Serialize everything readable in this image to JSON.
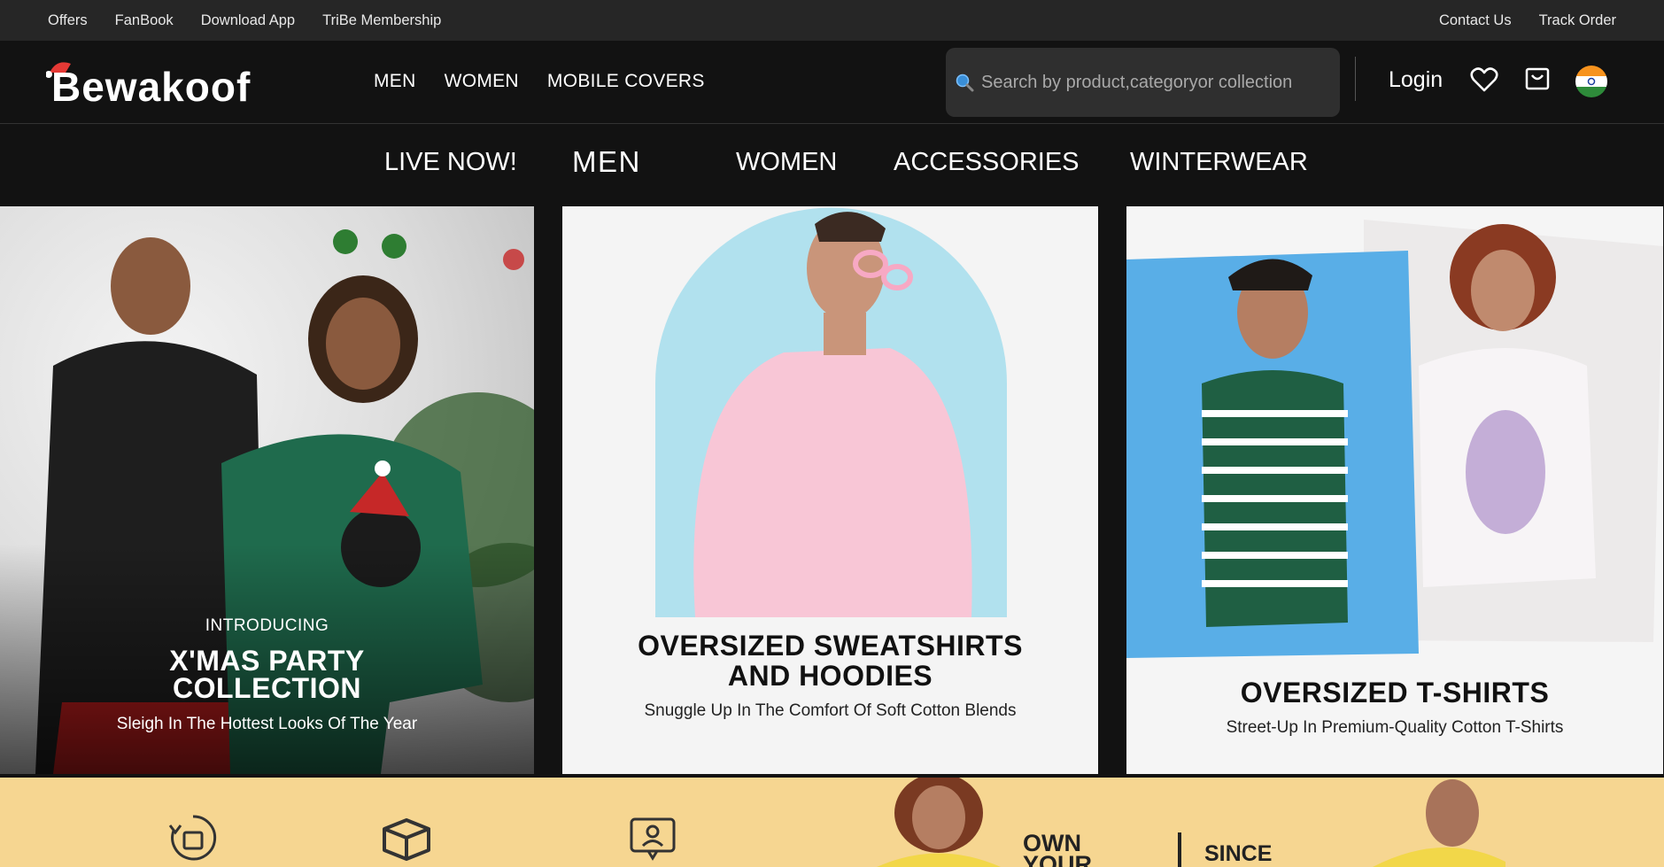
{
  "topbar": {
    "left_links": [
      "Offers",
      "FanBook",
      "Download App",
      "TriBe Membership"
    ],
    "right_links": [
      "Contact Us",
      "Track Order"
    ]
  },
  "header": {
    "logo_text": "Bewakoof",
    "nav": [
      "MEN",
      "WOMEN",
      "MOBILE COVERS"
    ],
    "search_placeholder": "Search by product,categoryor collection",
    "login_label": "Login"
  },
  "categories": [
    "LIVE NOW!",
    "MEN",
    "WOMEN",
    "ACCESSORIES",
    "WINTERWEAR"
  ],
  "banners": [
    {
      "intro": "INTRODUCING",
      "title_line1": "X'MAS PARTY",
      "title_line2": "COLLECTION",
      "subtitle": "Sleigh In The Hottest Looks Of The Year"
    },
    {
      "title_line1": "OVERSIZED SWEATSHIRTS",
      "title_line2": "AND HOODIES",
      "subtitle": "Snuggle Up In The Comfort Of Soft Cotton Blends"
    },
    {
      "title_line1": "OVERSIZED T-SHIRTS",
      "subtitle": "Street-Up In Premium-Quality Cotton T-Shirts"
    }
  ],
  "strip": {
    "own_line1": "OWN",
    "own_line2": "YOUR",
    "since": "SINCE"
  },
  "colors": {
    "topbar_bg": "#262626",
    "header_bg": "#121212",
    "strip_bg": "#f6d691",
    "logo_hat": "#e53935"
  },
  "icons": {
    "search": "search-icon",
    "wishlist": "heart-icon",
    "cart": "bag-icon",
    "country": "india-flag-icon"
  }
}
